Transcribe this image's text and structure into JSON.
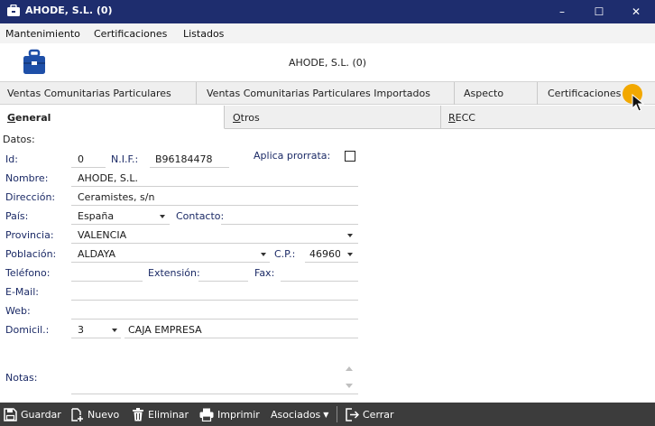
{
  "window": {
    "title": "AHODE, S.L. (0)",
    "minimize": "–",
    "maximize": "☐",
    "close": "✕"
  },
  "menu": [
    "Mantenimiento",
    "Certificaciones",
    "Listados"
  ],
  "header": {
    "company": "AHODE, S.L. (0)"
  },
  "tabs_top": [
    "Ventas Comunitarias Particulares",
    "Ventas Comunitarias Particulares Importados",
    "Aspecto",
    "Certificaciones"
  ],
  "tabs_sub": [
    {
      "label_first": "G",
      "label_rest": "eneral"
    },
    {
      "label_first": "O",
      "label_rest": "tros"
    },
    {
      "label_first": "R",
      "label_rest": "ECC"
    }
  ],
  "form": {
    "section": "Datos:",
    "id_label": "Id:",
    "id_value": "0",
    "nif_label": "N.I.F.:",
    "nif_value": "B96184478",
    "prorrata_label": "Aplica prorrata:",
    "nombre_label": "Nombre:",
    "nombre_value": "AHODE, S.L.",
    "direccion_label": "Dirección:",
    "direccion_value": "Ceramistes, s/n",
    "pais_label": "País:",
    "pais_value": "España",
    "contacto_label": "Contacto:",
    "contacto_value": "",
    "provincia_label": "Provincia:",
    "provincia_value": "VALENCIA",
    "poblacion_label": "Población:",
    "poblacion_value": "ALDAYA",
    "cp_label": "C.P.:",
    "cp_value": "46960",
    "telefono_label": "Teléfono:",
    "telefono_value": "",
    "extension_label": "Extensión:",
    "extension_value": "",
    "fax_label": "Fax:",
    "fax_value": "",
    "email_label": "E-Mail:",
    "email_value": "",
    "web_label": "Web:",
    "web_value": "",
    "domicil_label": "Domicil.:",
    "domicil_code": "3",
    "domicil_name": "CAJA EMPRESA",
    "notas_label": "Notas:"
  },
  "toolbar": {
    "guardar": "Guardar",
    "nuevo": "Nuevo",
    "eliminar": "Eliminar",
    "imprimir": "Imprimir",
    "asociados": "Asociados",
    "cerrar": "Cerrar"
  }
}
